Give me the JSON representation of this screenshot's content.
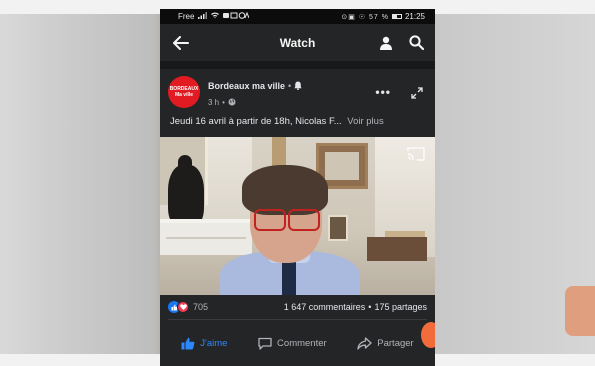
{
  "status_bar": {
    "carrier": "Free",
    "icons": "⊙▣ ☉ 57 %",
    "time": "21:25"
  },
  "nav": {
    "title": "Watch",
    "back_icon": "arrow-left-icon",
    "profile_icon": "person-icon",
    "search_icon": "search-icon"
  },
  "post": {
    "page_name": "Bordeaux ma ville",
    "page_name_suffix": "•",
    "avatar_line1": "BORDEAUX",
    "avatar_line2": "Ma ville",
    "time_ago": "3 h",
    "meta_separator": "•",
    "text": "Jeudi 16 avril à partir de 18h, Nicolas F...",
    "see_more": "Voir plus"
  },
  "reactions": {
    "count": "705",
    "comments": "1 647 commentaires",
    "separator": "•",
    "shares": "175 partages"
  },
  "actions": {
    "like": "J'aime",
    "comment": "Commenter",
    "share": "Partager"
  },
  "colors": {
    "facebook_blue": "#1877f2",
    "avatar_red": "#e21b23",
    "love_red": "#f33e58",
    "dark_surface": "#242526"
  }
}
